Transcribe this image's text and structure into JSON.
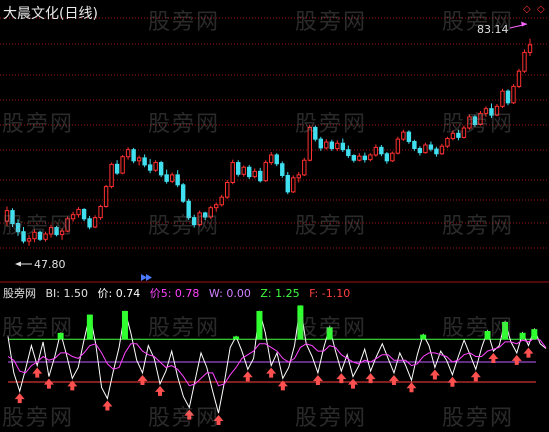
{
  "header": {
    "title": "大晨文化(日线)"
  },
  "price_labels": {
    "high": "83.14",
    "low": "47.80"
  },
  "indicator": {
    "name": "股旁网",
    "items": [
      {
        "key": "bi",
        "text": "BI: 1.50"
      },
      {
        "key": "jia",
        "text": "价: 0.74"
      },
      {
        "key": "jia5",
        "text": "价5: 0.78"
      },
      {
        "key": "w",
        "text": "W: 0.00"
      },
      {
        "key": "z",
        "text": "Z: 1.25"
      },
      {
        "key": "f",
        "text": "F: -1.10"
      }
    ]
  },
  "watermark": "股旁网",
  "colors": {
    "background": "#000000",
    "up_candle": "#ff3030",
    "down_candle": "#40e0f0",
    "grid": "#a01010",
    "z_line": "#40ff40",
    "f_line": "#ff4040",
    "w_line": "#c060ff",
    "jia_line": "#ffffff",
    "jia5_line": "#ff44ff",
    "green_bar": "#30ff30",
    "red_arrow": "#ff5050"
  },
  "icons": [
    "diamond-icon",
    "diamond-icon",
    "price-arrow-icon",
    "arrow-up-icon"
  ],
  "chart_data": [
    {
      "type": "candlestick",
      "title": "大晨文化(日线)",
      "annotations": [
        "83.14",
        "47.80"
      ],
      "ylim": [
        44,
        86
      ],
      "series": [
        {
          "values": [
            [
              52.0,
              54.5,
              51.2,
              53.8
            ],
            [
              53.8,
              54.2,
              51.0,
              51.6
            ],
            [
              51.6,
              52.3,
              49.5,
              50.2
            ],
            [
              50.2,
              51.0,
              48.2,
              48.6
            ],
            [
              48.6,
              49.6,
              47.8,
              49.0
            ],
            [
              49.0,
              50.6,
              48.4,
              50.1
            ],
            [
              50.1,
              50.4,
              48.6,
              48.9
            ],
            [
              48.9,
              50.2,
              48.5,
              49.8
            ],
            [
              49.8,
              51.4,
              49.2,
              50.9
            ],
            [
              50.9,
              51.2,
              49.4,
              49.7
            ],
            [
              49.7,
              50.8,
              48.8,
              50.3
            ],
            [
              50.3,
              52.8,
              50.1,
              52.4
            ],
            [
              52.4,
              53.6,
              51.9,
              53.1
            ],
            [
              53.1,
              54.4,
              52.6,
              54.0
            ],
            [
              54.0,
              54.2,
              52.0,
              52.4
            ],
            [
              52.4,
              52.9,
              50.6,
              51.0
            ],
            [
              51.0,
              53.0,
              50.8,
              52.6
            ],
            [
              52.6,
              54.8,
              52.2,
              54.5
            ],
            [
              54.5,
              58.2,
              54.3,
              57.9
            ],
            [
              57.9,
              62.0,
              57.6,
              61.7
            ],
            [
              61.7,
              62.4,
              59.9,
              60.2
            ],
            [
              60.2,
              63.3,
              60.0,
              63.0
            ],
            [
              63.0,
              64.6,
              62.5,
              64.2
            ],
            [
              64.2,
              64.5,
              61.9,
              62.3
            ],
            [
              62.3,
              63.2,
              61.5,
              62.8
            ],
            [
              62.8,
              63.4,
              61.2,
              61.6
            ],
            [
              61.6,
              62.6,
              60.2,
              60.7
            ],
            [
              60.7,
              62.4,
              60.4,
              62.0
            ],
            [
              62.0,
              62.3,
              59.5,
              59.9
            ],
            [
              59.9,
              60.8,
              58.4,
              58.8
            ],
            [
              58.8,
              60.3,
              58.5,
              59.9
            ],
            [
              59.9,
              60.7,
              57.8,
              58.2
            ],
            [
              58.2,
              58.5,
              55.1,
              55.4
            ],
            [
              55.4,
              55.8,
              52.2,
              52.6
            ],
            [
              52.6,
              53.1,
              50.9,
              51.4
            ],
            [
              51.4,
              53.8,
              51.1,
              53.4
            ],
            [
              53.4,
              53.6,
              52.2,
              52.7
            ],
            [
              52.7,
              54.6,
              52.4,
              54.3
            ],
            [
              54.3,
              55.2,
              53.6,
              54.8
            ],
            [
              54.8,
              56.5,
              54.5,
              56.1
            ],
            [
              56.1,
              59.0,
              55.8,
              58.6
            ],
            [
              58.6,
              62.5,
              58.3,
              62.0
            ],
            [
              62.0,
              62.4,
              59.6,
              60.0
            ],
            [
              60.0,
              61.5,
              59.6,
              61.2
            ],
            [
              61.2,
              61.6,
              59.2,
              59.6
            ],
            [
              59.6,
              61.0,
              59.3,
              60.5
            ],
            [
              60.5,
              61.1,
              58.6,
              58.9
            ],
            [
              58.9,
              62.4,
              58.7,
              62.0
            ],
            [
              62.0,
              63.8,
              61.6,
              63.3
            ],
            [
              63.3,
              63.6,
              61.4,
              61.8
            ],
            [
              61.8,
              62.2,
              59.4,
              59.8
            ],
            [
              59.8,
              60.4,
              56.6,
              57.0
            ],
            [
              57.0,
              59.8,
              56.8,
              59.4
            ],
            [
              59.4,
              60.4,
              58.6,
              59.9
            ],
            [
              59.9,
              62.8,
              59.7,
              62.4
            ],
            [
              62.4,
              68.4,
              62.2,
              68.0
            ],
            [
              68.0,
              68.3,
              65.6,
              66.0
            ],
            [
              66.0,
              66.4,
              64.0,
              64.5
            ],
            [
              64.5,
              66.0,
              64.2,
              65.5
            ],
            [
              65.5,
              65.9,
              64.0,
              64.4
            ],
            [
              64.4,
              65.8,
              64.0,
              65.3
            ],
            [
              65.3,
              66.1,
              63.8,
              64.2
            ],
            [
              64.2,
              64.9,
              62.8,
              63.2
            ],
            [
              63.2,
              63.4,
              62.0,
              62.4
            ],
            [
              62.4,
              63.6,
              62.2,
              63.1
            ],
            [
              63.1,
              63.7,
              62.0,
              62.5
            ],
            [
              62.5,
              63.6,
              62.2,
              63.3
            ],
            [
              63.3,
              65.1,
              63.0,
              64.6
            ],
            [
              64.6,
              65.0,
              63.1,
              63.5
            ],
            [
              63.5,
              63.8,
              61.8,
              62.3
            ],
            [
              62.3,
              63.9,
              62.1,
              63.6
            ],
            [
              63.6,
              66.4,
              63.4,
              66.0
            ],
            [
              66.0,
              67.6,
              65.7,
              67.2
            ],
            [
              67.2,
              67.5,
              65.2,
              65.6
            ],
            [
              65.6,
              65.9,
              64.0,
              64.4
            ],
            [
              64.4,
              64.8,
              63.2,
              63.7
            ],
            [
              63.7,
              65.4,
              63.5,
              65.0
            ],
            [
              65.0,
              65.6,
              63.9,
              64.3
            ],
            [
              64.3,
              64.7,
              63.0,
              63.5
            ],
            [
              63.5,
              65.2,
              63.3,
              64.8
            ],
            [
              64.8,
              66.4,
              64.5,
              66.1
            ],
            [
              66.1,
              67.5,
              65.8,
              67.0
            ],
            [
              67.0,
              67.6,
              65.8,
              66.3
            ],
            [
              66.3,
              68.3,
              66.1,
              67.9
            ],
            [
              67.9,
              70.2,
              67.6,
              69.8
            ],
            [
              69.8,
              70.1,
              68.1,
              68.5
            ],
            [
              68.5,
              70.8,
              68.3,
              70.4
            ],
            [
              70.4,
              71.6,
              69.8,
              71.2
            ],
            [
              71.2,
              72.1,
              69.6,
              70.1
            ],
            [
              70.1,
              72.0,
              69.9,
              71.6
            ],
            [
              71.6,
              74.6,
              71.3,
              74.2
            ],
            [
              74.2,
              74.5,
              71.8,
              72.2
            ],
            [
              72.2,
              75.4,
              72.0,
              75.0
            ],
            [
              75.0,
              78.0,
              74.7,
              77.6
            ],
            [
              77.6,
              81.3,
              77.3,
              80.8
            ],
            [
              80.8,
              83.14,
              80.2,
              82.1
            ]
          ]
        }
      ]
    },
    {
      "type": "line",
      "series": [
        {
          "name": "价",
          "values": [
            1.4,
            -0.6,
            -1.6,
            -0.4,
            0.9,
            -0.2,
            1.1,
            -0.8,
            0.3,
            1.6,
            0.4,
            -0.9,
            -0.3,
            1.2,
            2.6,
            1.0,
            -1.4,
            -2.0,
            -0.5,
            0.8,
            2.8,
            1.6,
            0.1,
            -0.6,
            0.9,
            0.2,
            -1.2,
            -0.5,
            0.6,
            -0.8,
            -1.9,
            -2.5,
            -1.0,
            0.5,
            -0.3,
            -1.6,
            -2.8,
            -1.1,
            0.8,
            1.4,
            0.6,
            -0.4,
            0.2,
            2.8,
            1.6,
            -0.2,
            0.5,
            -0.9,
            -0.3,
            0.9,
            3.1,
            1.0,
            0.3,
            -0.6,
            0.8,
            1.9,
            0.6,
            -0.5,
            0.4,
            -0.8,
            -0.2,
            0.7,
            -0.5,
            0.3,
            1.0,
            0.2,
            -0.6,
            0.5,
            -0.2,
            -1.0,
            0.4,
            1.5,
            0.9,
            -0.3,
            0.6,
            0.1,
            -0.7,
            0.3,
            1.2,
            0.4,
            -0.4,
            0.8,
            1.7,
            0.6,
            0.9,
            2.2,
            1.1,
            0.5,
            1.6,
            0.9,
            1.8,
            1.0,
            0.74
          ]
        },
        {
          "name": "价5",
          "values": [
            0.3,
            0.1,
            -0.5,
            -0.6,
            -0.2,
            0.0,
            0.3,
            0.1,
            0.2,
            0.5,
            0.5,
            0.3,
            0.2,
            0.5,
            0.9,
            1.0,
            0.5,
            -0.1,
            -0.4,
            -0.3,
            0.5,
            1.0,
            1.0,
            0.6,
            0.4,
            0.3,
            0.0,
            -0.3,
            -0.2,
            -0.4,
            -0.8,
            -1.3,
            -1.2,
            -0.9,
            -0.6,
            -0.6,
            -1.3,
            -1.2,
            -0.7,
            -0.3,
            0.2,
            0.4,
            0.6,
            1.0,
            1.0,
            0.8,
            0.6,
            0.2,
            0.0,
            0.2,
            0.8,
            1.0,
            0.9,
            0.6,
            0.6,
            0.9,
            0.8,
            0.4,
            0.2,
            0.0,
            -0.1,
            0.1,
            0.0,
            0.2,
            0.4,
            0.4,
            0.1,
            0.1,
            0.1,
            -0.2,
            -0.1,
            0.3,
            0.5,
            0.5,
            0.4,
            0.3,
            0.0,
            0.1,
            0.4,
            0.5,
            0.3,
            0.3,
            0.6,
            0.7,
            0.8,
            1.1,
            1.1,
            1.0,
            1.2,
            1.1,
            1.3,
            1.2,
            0.78
          ]
        }
      ],
      "levels": {
        "BI": 1.5,
        "W": 0.0,
        "Z": 1.25,
        "F": -1.1
      },
      "ylim": [
        -3.4,
        3.4
      ]
    }
  ]
}
